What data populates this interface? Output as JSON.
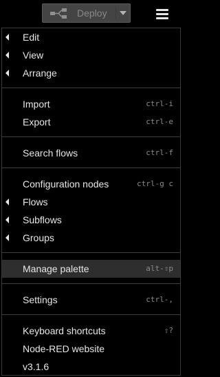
{
  "header": {
    "deploy_label": "Deploy",
    "deploy_icon": "deploy-flow-icon",
    "menu_icon": "hamburger-menu-icon"
  },
  "menu": {
    "edit": {
      "label": "Edit",
      "has_submenu": true
    },
    "view": {
      "label": "View",
      "has_submenu": true
    },
    "arrange": {
      "label": "Arrange",
      "has_submenu": true
    },
    "import": {
      "label": "Import",
      "shortcut": "ctrl-i"
    },
    "export": {
      "label": "Export",
      "shortcut": "ctrl-e"
    },
    "search_flows": {
      "label": "Search flows",
      "shortcut": "ctrl-f"
    },
    "configuration_nodes": {
      "label": "Configuration nodes",
      "shortcut": "ctrl-g c"
    },
    "flows": {
      "label": "Flows",
      "has_submenu": true
    },
    "subflows": {
      "label": "Subflows",
      "has_submenu": true
    },
    "groups": {
      "label": "Groups",
      "has_submenu": true
    },
    "manage_palette": {
      "label": "Manage palette",
      "shortcut": "alt-⇧p",
      "highlighted": true
    },
    "settings": {
      "label": "Settings",
      "shortcut": "ctrl-,"
    },
    "keyboard_shortcuts": {
      "label": "Keyboard shortcuts",
      "shortcut": "⇧?"
    },
    "node_red_website": {
      "label": "Node-RED website"
    },
    "version": {
      "label": "v3.1.6"
    }
  },
  "colors": {
    "background": "#000000",
    "text": "#e6e6e6",
    "shortcut_text": "#8a8a8a",
    "highlight": "#2e2e2e",
    "deploy_bg": "#444444"
  }
}
